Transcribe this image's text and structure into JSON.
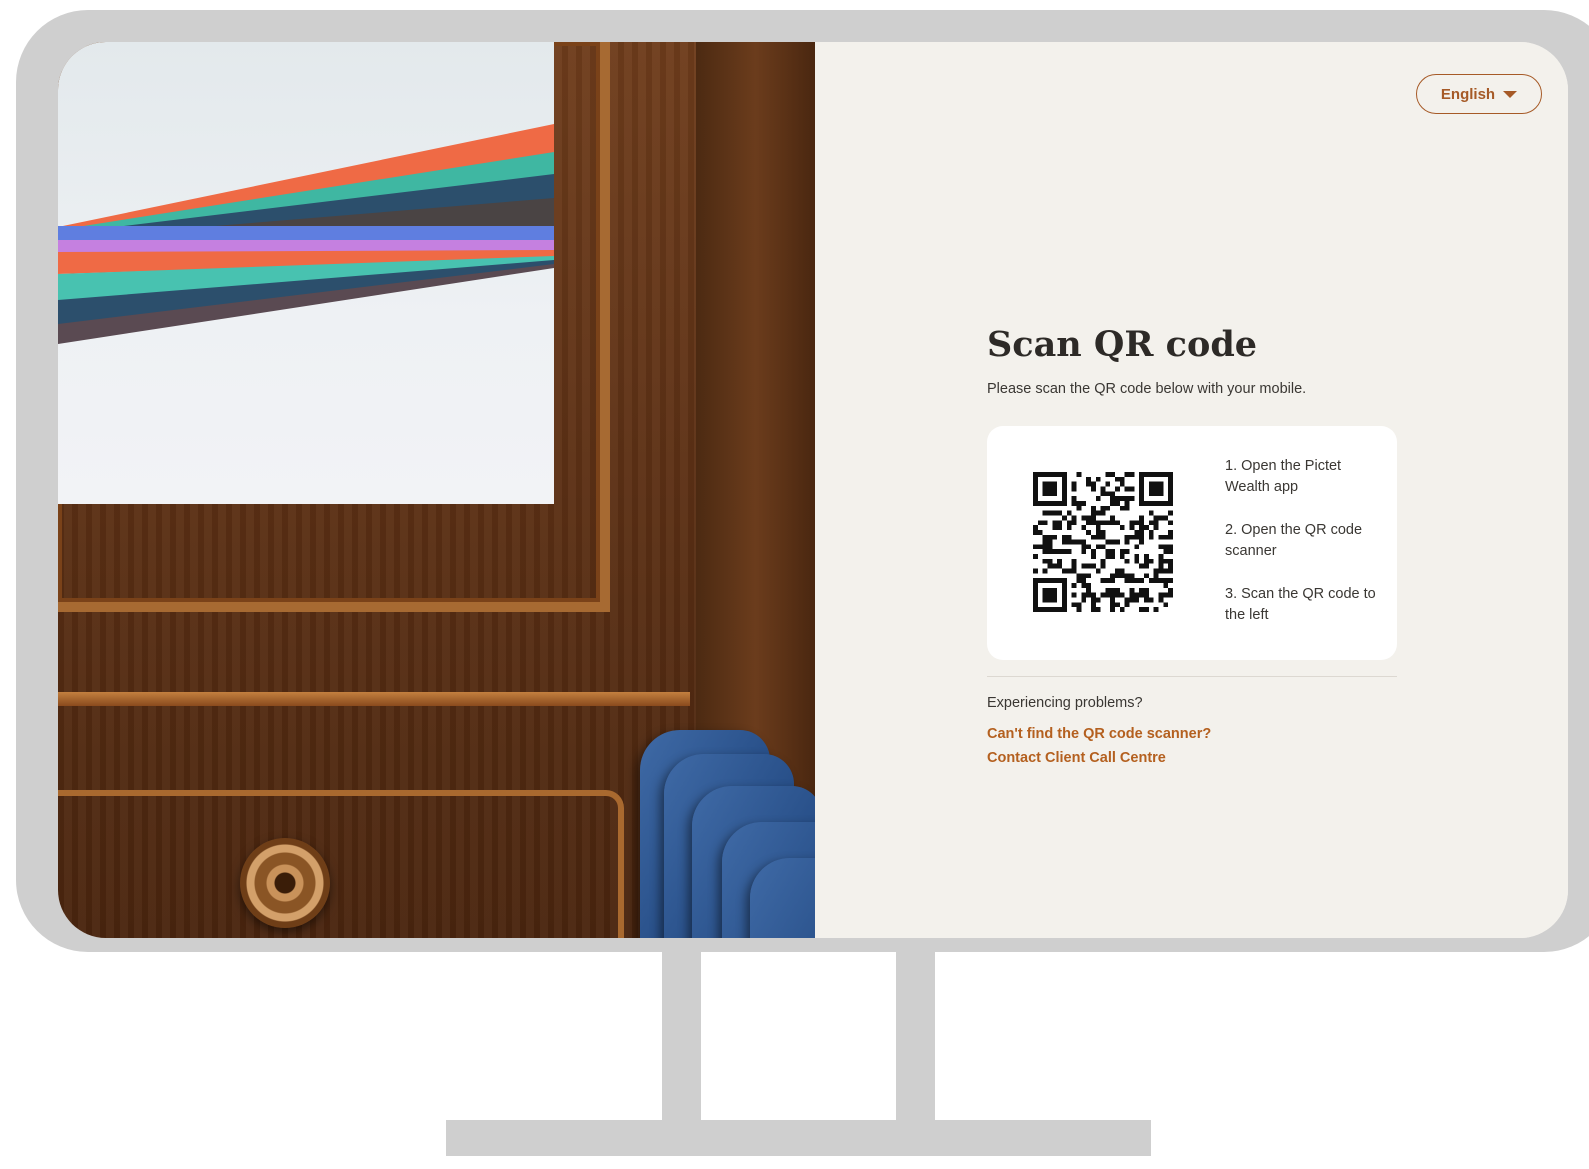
{
  "header": {
    "language_label": "English"
  },
  "main": {
    "title": "Scan QR code",
    "subtitle": "Please scan the QR code below with your mobile.",
    "steps": [
      "1. Open the Pictet Wealth app",
      "2. Open the QR code scanner",
      "3. Scan the QR code to the left"
    ]
  },
  "help": {
    "heading": "Experiencing problems?",
    "links": [
      "Can't find the QR code scanner?",
      "Contact Client Call Centre"
    ]
  },
  "colors": {
    "accent": "#b4601f",
    "background": "#f3f1ec",
    "card": "#ffffff",
    "text": "#2d2a27"
  },
  "icons": {
    "language_dropdown": "caret-down-icon",
    "qr": "qr-code-image"
  }
}
